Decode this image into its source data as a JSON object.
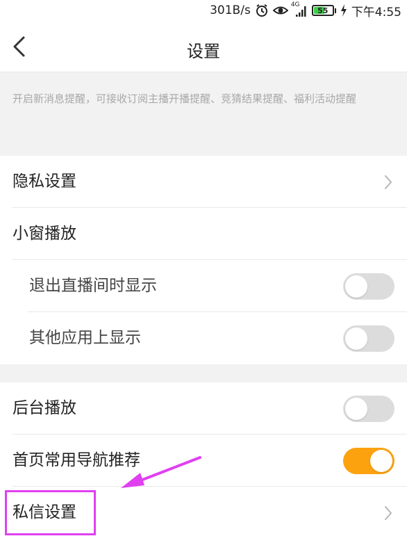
{
  "status_bar": {
    "network_speed": "301B/s",
    "network_type": "4G",
    "battery_level": "55",
    "time": "下午4:55",
    "icons": [
      "alarm-icon",
      "eye-icon",
      "signal-icon",
      "battery-icon",
      "charging-icon"
    ]
  },
  "nav": {
    "title": "设置",
    "back_icon": "chevron-left-icon"
  },
  "hint": {
    "text": "开启新消息提醒，可接收订阅主播开播提醒、竞猜结果提醒、福利活动提醒"
  },
  "settings": {
    "privacy_label": "隐私设置",
    "mini_window_label": "小窗播放",
    "exit_live_label": "退出直播间时显示",
    "exit_live_enabled": false,
    "other_apps_label": "其他应用上显示",
    "other_apps_enabled": false,
    "background_play_label": "后台播放",
    "background_play_enabled": false,
    "home_nav_label": "首页常用导航推荐",
    "home_nav_enabled": true,
    "private_msg_label": "私信设置"
  },
  "colors": {
    "accent": "#fca20f",
    "toggle_off": "#dcdcdc",
    "section_bg": "#f2f2f2",
    "annotation": "#e040f0"
  }
}
